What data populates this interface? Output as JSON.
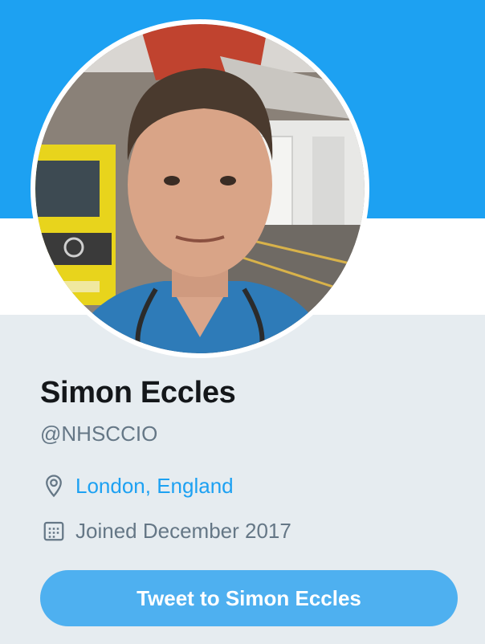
{
  "colors": {
    "banner": "#1da1f2",
    "link": "#1da1f2",
    "muted": "#657786",
    "button": "#4eb0f0",
    "background": "#e6ecf0"
  },
  "profile": {
    "name": "Simon Eccles",
    "handle": "@NHSCCIO",
    "location": "London, England",
    "location_icon": "location-pin-icon",
    "joined": "Joined December 2017",
    "joined_icon": "calendar-icon"
  },
  "actions": {
    "tweet_to": "Tweet to Simon Eccles"
  }
}
